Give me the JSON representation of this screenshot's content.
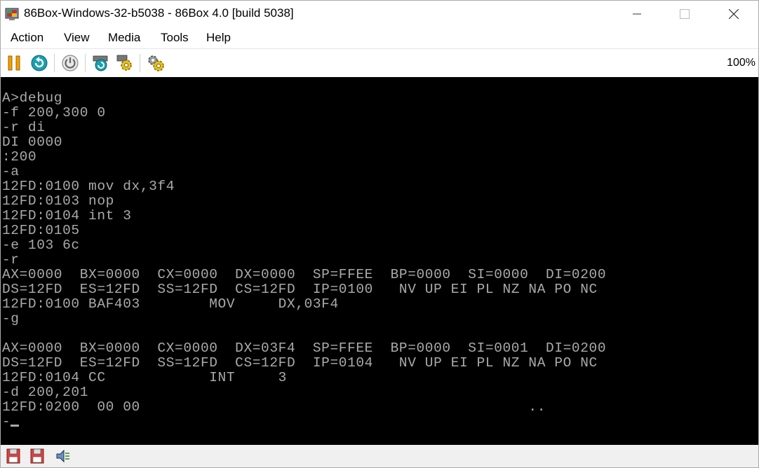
{
  "window": {
    "title": "86Box-Windows-32-b5038 - 86Box 4.0 [build 5038]",
    "controls": {
      "minimize": "—",
      "maximize": "☐",
      "close": "✕"
    }
  },
  "menu": {
    "items": [
      "Action",
      "View",
      "Media",
      "Tools",
      "Help"
    ]
  },
  "toolbar": {
    "icons": [
      "pause-icon",
      "reset-icon",
      "power-icon",
      "ctrl-alt-del-icon",
      "settings-icon",
      "gears-icon"
    ],
    "zoom": "100%"
  },
  "terminal": {
    "lines": [
      "A>debug",
      "-f 200,300 0",
      "-r di",
      "DI 0000",
      ":200",
      "-a",
      "12FD:0100 mov dx,3f4",
      "12FD:0103 nop",
      "12FD:0104 int 3",
      "12FD:0105",
      "-e 103 6c",
      "-r",
      "AX=0000  BX=0000  CX=0000  DX=0000  SP=FFEE  BP=0000  SI=0000  DI=0200",
      "DS=12FD  ES=12FD  SS=12FD  CS=12FD  IP=0100   NV UP EI PL NZ NA PO NC",
      "12FD:0100 BAF403        MOV     DX,03F4",
      "-g",
      "",
      "AX=0000  BX=0000  CX=0000  DX=03F4  SP=FFEE  BP=0000  SI=0001  DI=0200",
      "DS=12FD  ES=12FD  SS=12FD  CS=12FD  IP=0104   NV UP EI PL NZ NA PO NC",
      "12FD:0104 CC            INT     3",
      "-d 200,201",
      "12FD:0200  00 00                                             ..",
      "-"
    ],
    "text_color": "#aaaaaa",
    "background": "#000000"
  },
  "statusbar": {
    "icons": [
      "floppy-drive-1-icon",
      "floppy-drive-2-icon",
      "sound-icon"
    ]
  },
  "colors": {
    "pause_orange": "#f0a000",
    "reset_teal": "#1aa0b0",
    "gear_yellow": "#e0c020",
    "floppy_red": "#e04040"
  }
}
